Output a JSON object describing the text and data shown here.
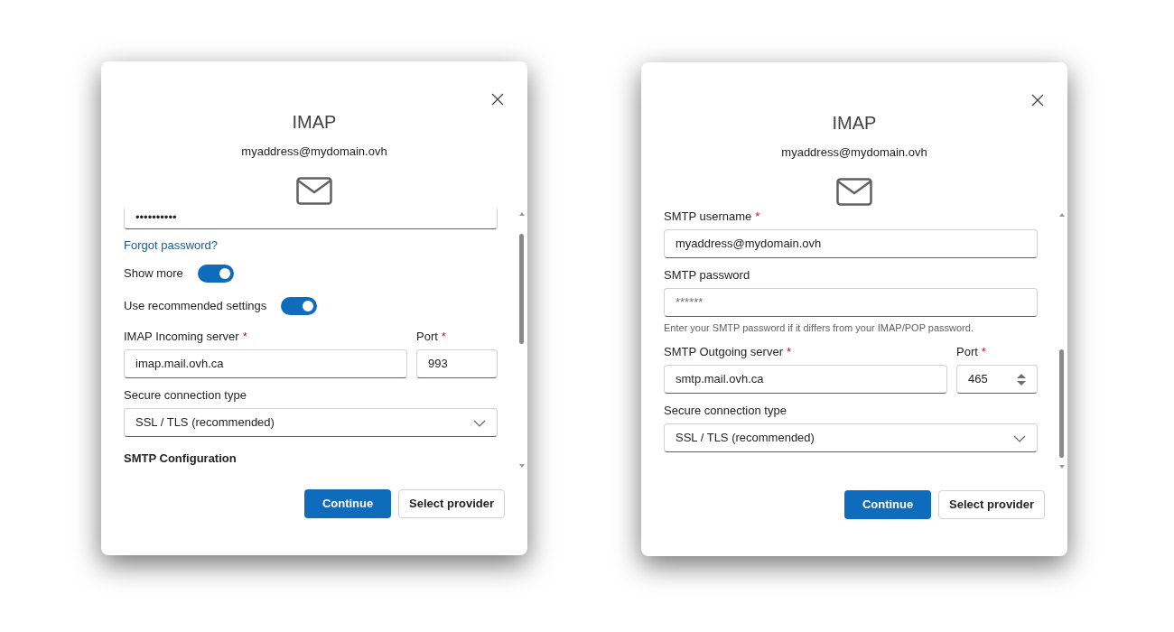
{
  "dialogs": [
    {
      "title": "IMAP",
      "email": "myaddress@mydomain.ovh",
      "items": [
        {
          "kind": "input",
          "value": "••••••••••",
          "cut": true
        },
        {
          "kind": "link",
          "text": "Forgot password?"
        },
        {
          "kind": "toggle",
          "label": "Show more",
          "on": true
        },
        {
          "kind": "toggle",
          "label": "Use recommended settings",
          "on": true
        },
        {
          "kind": "row",
          "fields": [
            {
              "label": "IMAP Incoming server",
              "required_mark": "*",
              "value": "imap.mail.ovh.ca"
            },
            {
              "label": "Port",
              "required_mark": "*",
              "value": "993"
            }
          ]
        },
        {
          "kind": "select",
          "label": "Secure connection type",
          "value": "SSL / TLS (recommended)"
        },
        {
          "kind": "heading",
          "text": "SMTP Configuration"
        }
      ],
      "buttons": [
        {
          "label": "Continue",
          "primary": true
        },
        {
          "label": "Select provider",
          "primary": false
        }
      ]
    },
    {
      "title": "IMAP",
      "email": "myaddress@mydomain.ovh",
      "items": [
        {
          "kind": "input",
          "label": "SMTP username",
          "required_mark": "*",
          "value": "myaddress@mydomain.ovh"
        },
        {
          "kind": "input",
          "label": "SMTP password",
          "placeholder": "******",
          "hint": "Enter your SMTP password if it differs from your IMAP/POP password."
        },
        {
          "kind": "row",
          "fields": [
            {
              "label": "SMTP Outgoing server",
              "required_mark": "*",
              "value": "smtp.mail.ovh.ca"
            },
            {
              "label": "Port",
              "required_mark": "*",
              "value": "465",
              "spinner": true
            }
          ]
        },
        {
          "kind": "select",
          "label": "Secure connection type",
          "value": "SSL / TLS (recommended)"
        }
      ],
      "buttons": [
        {
          "label": "Continue",
          "primary": true
        },
        {
          "label": "Select provider",
          "primary": false
        }
      ]
    }
  ]
}
